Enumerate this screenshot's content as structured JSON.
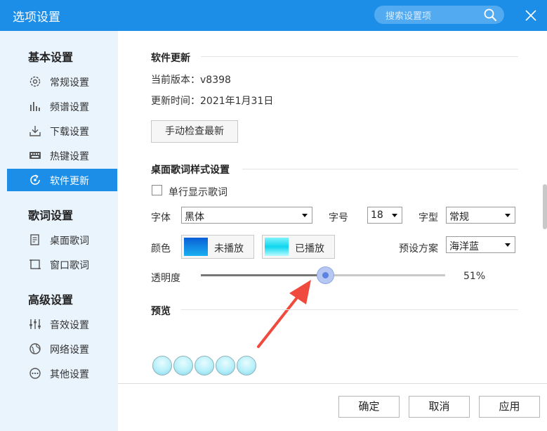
{
  "window": {
    "title": "选项设置"
  },
  "search": {
    "placeholder": "搜索设置项"
  },
  "sidebar": {
    "groups": [
      {
        "title": "基本设置",
        "items": [
          {
            "label": "常规设置",
            "icon": "gear-icon"
          },
          {
            "label": "频谱设置",
            "icon": "spectrum-icon"
          },
          {
            "label": "下载设置",
            "icon": "download-icon"
          },
          {
            "label": "热键设置",
            "icon": "keyboard-icon"
          },
          {
            "label": "软件更新",
            "icon": "update-icon",
            "active": true
          }
        ]
      },
      {
        "title": "歌词设置",
        "items": [
          {
            "label": "桌面歌词",
            "icon": "desktop-lyrics-icon"
          },
          {
            "label": "窗口歌词",
            "icon": "window-lyrics-icon"
          }
        ]
      },
      {
        "title": "高级设置",
        "items": [
          {
            "label": "音效设置",
            "icon": "equalizer-icon"
          },
          {
            "label": "网络设置",
            "icon": "network-icon"
          },
          {
            "label": "其他设置",
            "icon": "more-icon"
          }
        ]
      }
    ]
  },
  "update": {
    "title": "软件更新",
    "version_label": "当前版本：",
    "version": "v8398",
    "time_label": "更新时间：",
    "time": "2021年1月31日",
    "check_button": "手动检查最新"
  },
  "lyrics_style": {
    "title": "桌面歌词样式设置",
    "single_line_label": "单行显示歌词",
    "single_line_checked": false,
    "font_label": "字体",
    "font_value": "黑体",
    "size_label": "字号",
    "size_value": "18",
    "style_label": "字型",
    "style_value": "常规",
    "color_label": "颜色",
    "unplayed_label": "未播放",
    "played_label": "已播放",
    "preset_label": "预设方案",
    "preset_value": "海洋蓝",
    "opacity_label": "透明度",
    "opacity_percent": 51,
    "opacity_text": "51%"
  },
  "preview": {
    "title": "预览"
  },
  "footer": {
    "ok": "确定",
    "cancel": "取消",
    "apply": "应用"
  },
  "colors": {
    "accent": "#1c8ee8",
    "sidebar_bg": "#eaf4fd",
    "arrow": "#f04a3e"
  }
}
